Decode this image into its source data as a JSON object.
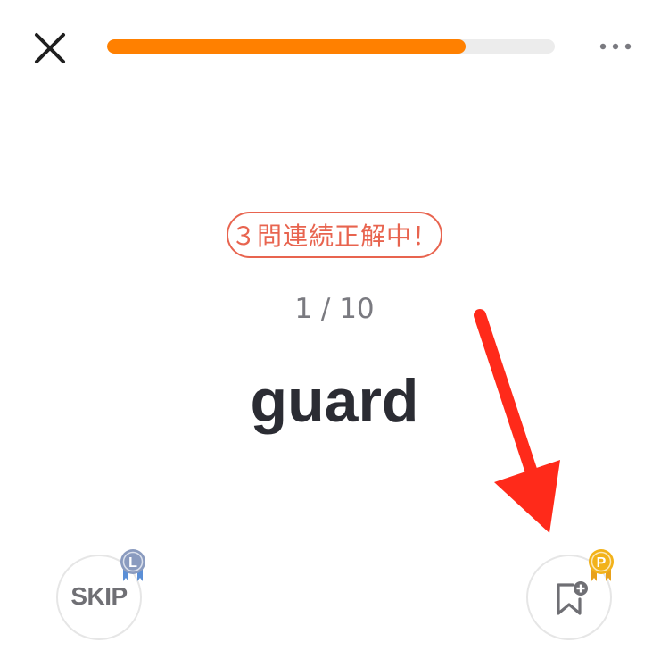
{
  "header": {
    "close_icon": "close-icon",
    "more_icon": "more-horizontal-icon",
    "progress": {
      "value": 0.8,
      "fill_color": "#ff8000",
      "track_color": "#ececec"
    }
  },
  "quiz": {
    "streak_badge": "３問連続正解中！",
    "counter": "1 / 10",
    "word": "guard",
    "accent_color": "#e8644f"
  },
  "actions": {
    "skip": {
      "label": "SKIP",
      "medal_letter": "L",
      "medal_color": "#8a9bbf",
      "ribbon_color": "#5b8fd6"
    },
    "bookmark": {
      "icon": "bookmark-add-icon",
      "medal_letter": "P",
      "medal_color": "#f2b21a",
      "ribbon_color": "#e8a11c"
    }
  },
  "annotation": {
    "icon": "red-arrow-icon",
    "color": "#ff2a1a"
  }
}
